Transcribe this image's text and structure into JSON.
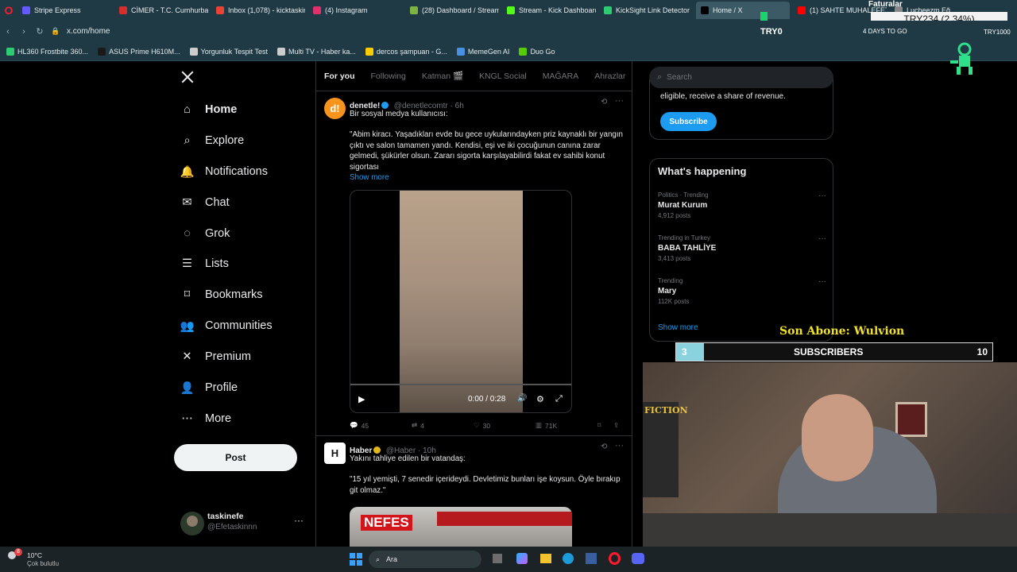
{
  "browser": {
    "tabs": [
      {
        "label": "Stripe Express",
        "color": "#635bff"
      },
      {
        "label": "CİMER - T.C. Cumhurbaşk",
        "color": "#d32f2f"
      },
      {
        "label": "Inbox (1,078) - kicktaskin",
        "color": "#ea4335"
      },
      {
        "label": "(4) Instagram",
        "color": "#e1306c"
      },
      {
        "label": "(28) Dashboard / Stream",
        "color": "#7cb342"
      },
      {
        "label": "Stream - Kick Dashboard",
        "color": "#53fc18"
      },
      {
        "label": "KickSight Link Detector",
        "color": "#2ecc71"
      },
      {
        "label": "Home / X",
        "color": "#000000"
      },
      {
        "label": "(1) SAHTE MUHALEFET",
        "color": "#ff0000"
      },
      {
        "label": "Lucheezm Eğ...",
        "color": "#888888"
      }
    ],
    "url": "x.com/home",
    "bookmarks": [
      "HL360 Frostbite 360...",
      "ASUS Prime H610M...",
      "Yorgunluk Tespit Test",
      "Multi TV - Haber ka...",
      "dercos şampuan - G...",
      "MemeGen AI",
      "Duo Go"
    ]
  },
  "overlay": {
    "faturalar": "Faturalar",
    "ticker": "TRY234 (2.34%)",
    "try0": "TRY0",
    "days_to_go": "4 DAYS TO GO",
    "try_right": "TRY1000",
    "son_abone": "Son Abone: Wulvion",
    "sub_current": "3",
    "sub_label": "SUBSCRIBERS",
    "sub_goal": "10",
    "sub_fraction": 0.3
  },
  "sidebar": {
    "items": [
      {
        "label": "Home",
        "icon": "home-icon"
      },
      {
        "label": "Explore",
        "icon": "search-icon"
      },
      {
        "label": "Notifications",
        "icon": "bell-icon"
      },
      {
        "label": "Chat",
        "icon": "mail-icon"
      },
      {
        "label": "Grok",
        "icon": "grok-icon"
      },
      {
        "label": "Lists",
        "icon": "list-icon"
      },
      {
        "label": "Bookmarks",
        "icon": "bookmark-icon"
      },
      {
        "label": "Communities",
        "icon": "people-icon"
      },
      {
        "label": "Premium",
        "icon": "x-icon"
      },
      {
        "label": "Profile",
        "icon": "user-icon"
      },
      {
        "label": "More",
        "icon": "more-icon"
      }
    ],
    "post_label": "Post",
    "account_name": "taskinefe",
    "account_handle": "@Efetaskinnn"
  },
  "feed": {
    "tabs": [
      "For you",
      "Following",
      "Katman 🎬",
      "KNGL Social",
      "MAĞARA",
      "Ahrazlar"
    ],
    "post1": {
      "name": "denetle!",
      "handle": "@denetlecomtr · 6h",
      "line1": "Bir sosyal medya kullanıcısı:",
      "text": "\"Abim kiracı. Yaşadıkları evde bu gece uykularındayken priz kaynaklı bir yangın çıktı ve salon tamamen yandı. Kendisi, eşi ve iki çocuğunun canına zarar gelmedi, şükürler olsun. Zararı sigorta karşılayabilirdi fakat ev sahibi konut sigortası",
      "show_more": "Show more",
      "video_time": "0:00 / 0:28",
      "replies": "45",
      "reposts": "4",
      "likes": "30",
      "views": "71K"
    },
    "post2": {
      "name": "Haber",
      "handle": "@Haber · 10h",
      "line1": "Yakını tahliye edilen bir vatandaş:",
      "text": "\"15 yıl yemişti, 7 senedir içerideydi. Devletimiz bunları işe koysun. Öyle bırakıp git olmaz.\"",
      "image_text": "NEFES"
    }
  },
  "right": {
    "search_placeholder": "Search",
    "premium_text": "eligible, receive a share of revenue.",
    "subscribe_label": "Subscribe",
    "happening_title": "What's happening",
    "trends": [
      {
        "category": "Politics · Trending",
        "title": "Murat Kurum",
        "count": "4,912 posts"
      },
      {
        "category": "Trending in Turkey",
        "title": "BABA TAHLİYE",
        "count": "3,413 posts"
      },
      {
        "category": "Trending",
        "title": "Mary",
        "count": "112K posts"
      }
    ],
    "show_more": "Show more"
  },
  "taskbar": {
    "temp": "10°C",
    "weather": "Çok bulutlu",
    "search": "Ara",
    "notif_count": "8"
  },
  "colors": {
    "accent": "#1d9bf0",
    "background": "#000000",
    "browser_chrome": "#1f3a44",
    "sub_fill": "#8ad3de"
  }
}
